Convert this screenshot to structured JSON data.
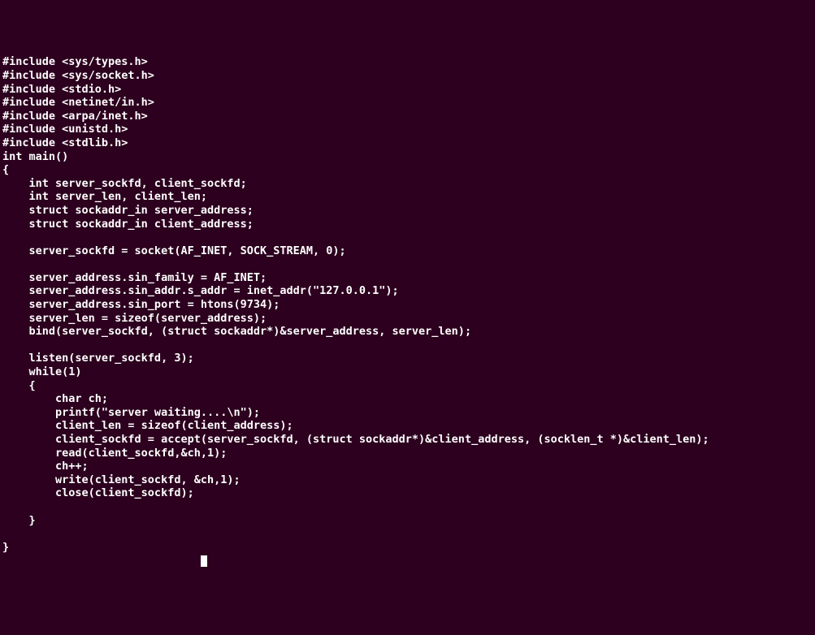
{
  "code": {
    "lines": [
      "#include <sys/types.h>",
      "#include <sys/socket.h>",
      "#include <stdio.h>",
      "#include <netinet/in.h>",
      "#include <arpa/inet.h>",
      "#include <unistd.h>",
      "#include <stdlib.h>",
      "int main()",
      "{",
      "    int server_sockfd, client_sockfd;",
      "    int server_len, client_len;",
      "    struct sockaddr_in server_address;",
      "    struct sockaddr_in client_address;",
      "",
      "    server_sockfd = socket(AF_INET, SOCK_STREAM, 0);",
      "",
      "    server_address.sin_family = AF_INET;",
      "    server_address.sin_addr.s_addr = inet_addr(\"127.0.0.1\");",
      "    server_address.sin_port = htons(9734);",
      "    server_len = sizeof(server_address);",
      "    bind(server_sockfd, (struct sockaddr*)&server_address, server_len);",
      "",
      "    listen(server_sockfd, 3);",
      "    while(1)",
      "    {",
      "        char ch;",
      "        printf(\"server waiting....\\n\");",
      "        client_len = sizeof(client_address);",
      "        client_sockfd = accept(server_sockfd, (struct sockaddr*)&client_address, (socklen_t *)&client_len);",
      "        read(client_sockfd,&ch,1);",
      "        ch++;",
      "        write(client_sockfd, &ch,1);",
      "        close(client_sockfd);",
      "",
      "    }",
      "",
      "}"
    ]
  }
}
